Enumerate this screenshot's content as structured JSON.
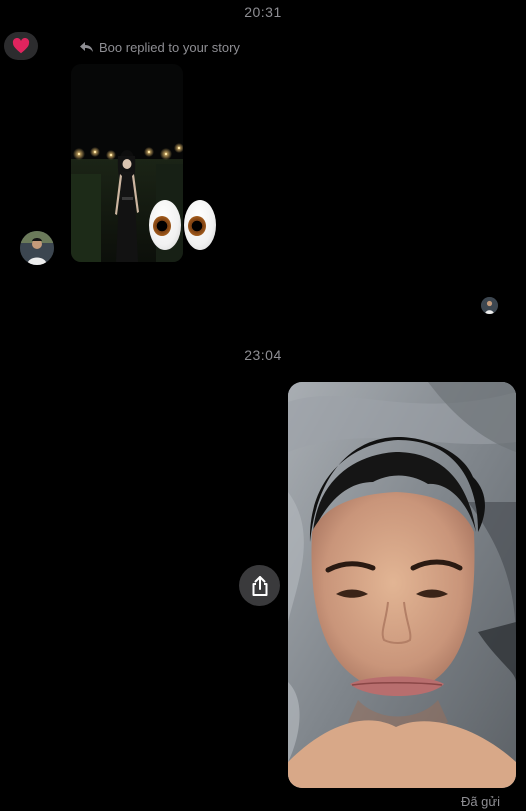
{
  "conversation": {
    "timestamp_1": "20:31",
    "timestamp_2": "23:04",
    "reaction_emoji": "❤️",
    "story_reply_label": "Boo replied to your story",
    "reply_icon": "reply-arrow-icon",
    "sent_status": "Đã gửi"
  },
  "icons": {
    "share": "share-icon",
    "heart": "heart-icon",
    "eyes": "eyes-emoji"
  },
  "colors": {
    "background": "#000000",
    "muted_text": "#8e8e93",
    "bubble": "#2c2c2e",
    "heart": "#e0245e"
  }
}
